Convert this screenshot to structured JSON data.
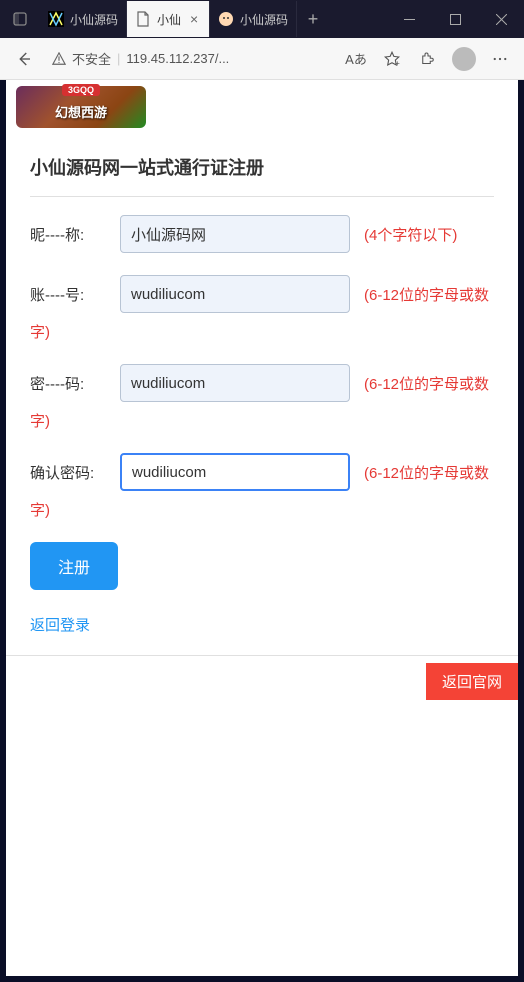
{
  "titlebar": {
    "tabs": [
      {
        "label": "小仙源码"
      },
      {
        "label": "小仙"
      },
      {
        "label": "小仙源码"
      }
    ]
  },
  "addressbar": {
    "security_text": "不安全",
    "url": "119.45.112.237/...",
    "reader_label": "Aあ"
  },
  "page": {
    "logo_badge": "3GQQ",
    "logo_text": "幻想西游",
    "form_title": "小仙源码网一站式通行证注册",
    "fields": {
      "nickname": {
        "label": "昵----称:",
        "value": "小仙源码网",
        "hint": "(4个字符以下)"
      },
      "account": {
        "label": "账----号:",
        "value": "wudiliucom",
        "hint": "(6-12位的字母或数",
        "hint2": "字)"
      },
      "password": {
        "label": "密----码:",
        "value": "wudiliucom",
        "hint": "(6-12位的字母或数",
        "hint2": "字)"
      },
      "confirm": {
        "label": "确认密码:",
        "value": "wudiliucom",
        "hint": "(6-12位的字母或数",
        "hint2": "字)"
      }
    },
    "submit_label": "注册",
    "back_link": "返回登录",
    "return_btn": "返回官网"
  }
}
